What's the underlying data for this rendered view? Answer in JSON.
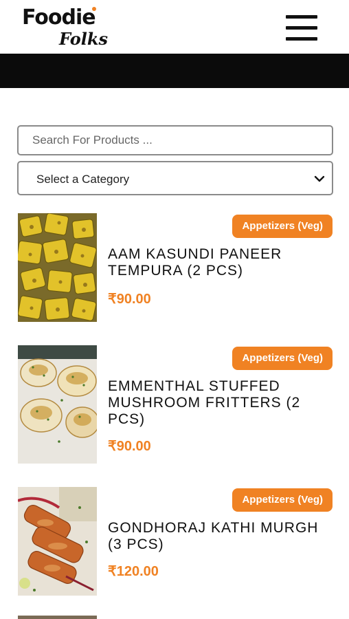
{
  "brand": {
    "name_top": "Foodie",
    "name_bottom": "Folks",
    "accent": "#f08223"
  },
  "header": {
    "menu_icon": "hamburger-menu-icon"
  },
  "search": {
    "placeholder": "Search For Products ..."
  },
  "category_select": {
    "selected": "Select a Category",
    "icon": "chevron-down-icon"
  },
  "products": [
    {
      "category": "Appetizers (Veg)",
      "title": "AAM KASUNDI PANEER TEMPURA (2 PCS)",
      "price": "₹90.00"
    },
    {
      "category": "Appetizers (Veg)",
      "title": "EMMENTHAL STUFFED MUSHROOM FRITTERS (2 PCS)",
      "price": "₹90.00"
    },
    {
      "category": "Appetizers (Veg)",
      "title": "GONDHORAJ KATHI MURGH (3 PCS)",
      "price": "₹120.00"
    }
  ]
}
